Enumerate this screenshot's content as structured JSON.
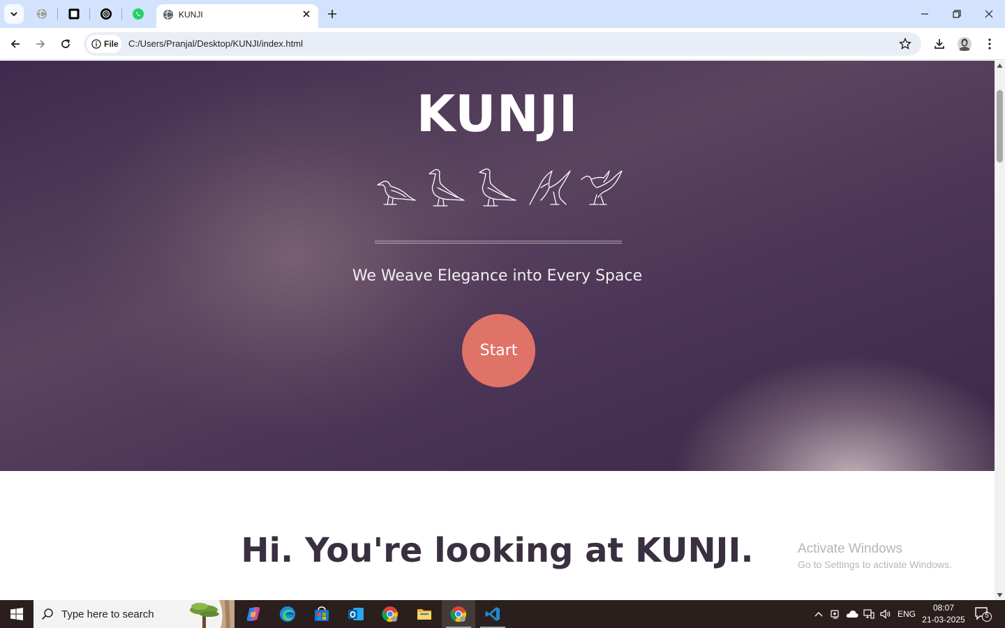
{
  "browser": {
    "active_tab_title": "KUNJI",
    "address_chip": "File",
    "url": "C:/Users/Pranjal/Desktop/KUNJI/index.html"
  },
  "page": {
    "hero_title": "KUNJI",
    "tagline": "We Weave Elegance into Every Space",
    "start_label": "Start",
    "intro_prefix": "Hi. You're looking at ",
    "intro_brand": "KUNJI",
    "intro_suffix": "."
  },
  "watermark": {
    "line1": "Activate Windows",
    "line2": "Go to Settings to activate Windows."
  },
  "taskbar": {
    "search_placeholder": "Type here to search",
    "language": "ENG",
    "time": "08:07",
    "date": "21-03-2025",
    "notification_count": "5"
  },
  "colors": {
    "start_button": "#e07368",
    "tab_strip": "#d3e3fd",
    "taskbar": "#2b1f1d"
  }
}
